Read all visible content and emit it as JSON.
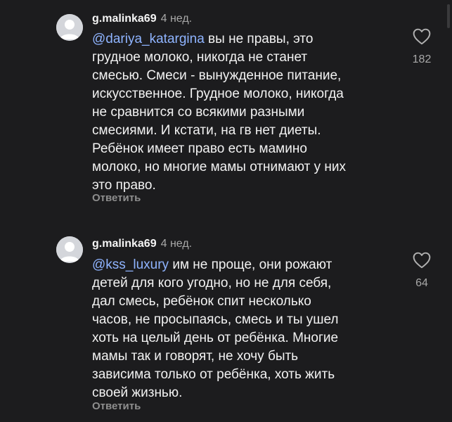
{
  "comments": [
    {
      "username": "g.malinka69",
      "time": "4 нед.",
      "mention": "@dariya_katargina",
      "text_lines": [
        " вы не правы, это",
        "грудное молоко, никогда не станет",
        "смесью. Смеси - вынужденное питание,",
        "искусственное. Грудное молоко, никогда",
        "не сравнится со всякими разными",
        "смесиями. И кстати, на гв нет диеты.",
        "Ребёнок имеет право есть мамино",
        "молоко, но многие мамы отнимают у них",
        "это право."
      ],
      "reply_label": "Ответить",
      "likes": "182",
      "like_icon": "heart-outline-icon"
    },
    {
      "username": "g.malinka69",
      "time": "4 нед.",
      "mention": "@kss_luxury",
      "text_lines": [
        " им не проще, они рожают",
        "детей для кого угодно, но не для себя,",
        "дал смесь, ребёнок спит несколько",
        "часов, не просыпаясь, смесь и ты ушел",
        "хоть на целый день от ребёнка. Многие",
        "мамы так и говорят, не хочу быть",
        "зависима только от ребёнка, хоть жить",
        "своей жизнью."
      ],
      "reply_label": "Ответить",
      "likes": "64",
      "like_icon": "heart-outline-icon"
    }
  ],
  "colors": {
    "background": "#1c1c1e",
    "mention": "#8fb4ff",
    "secondary_text": "#a8a8a8"
  }
}
